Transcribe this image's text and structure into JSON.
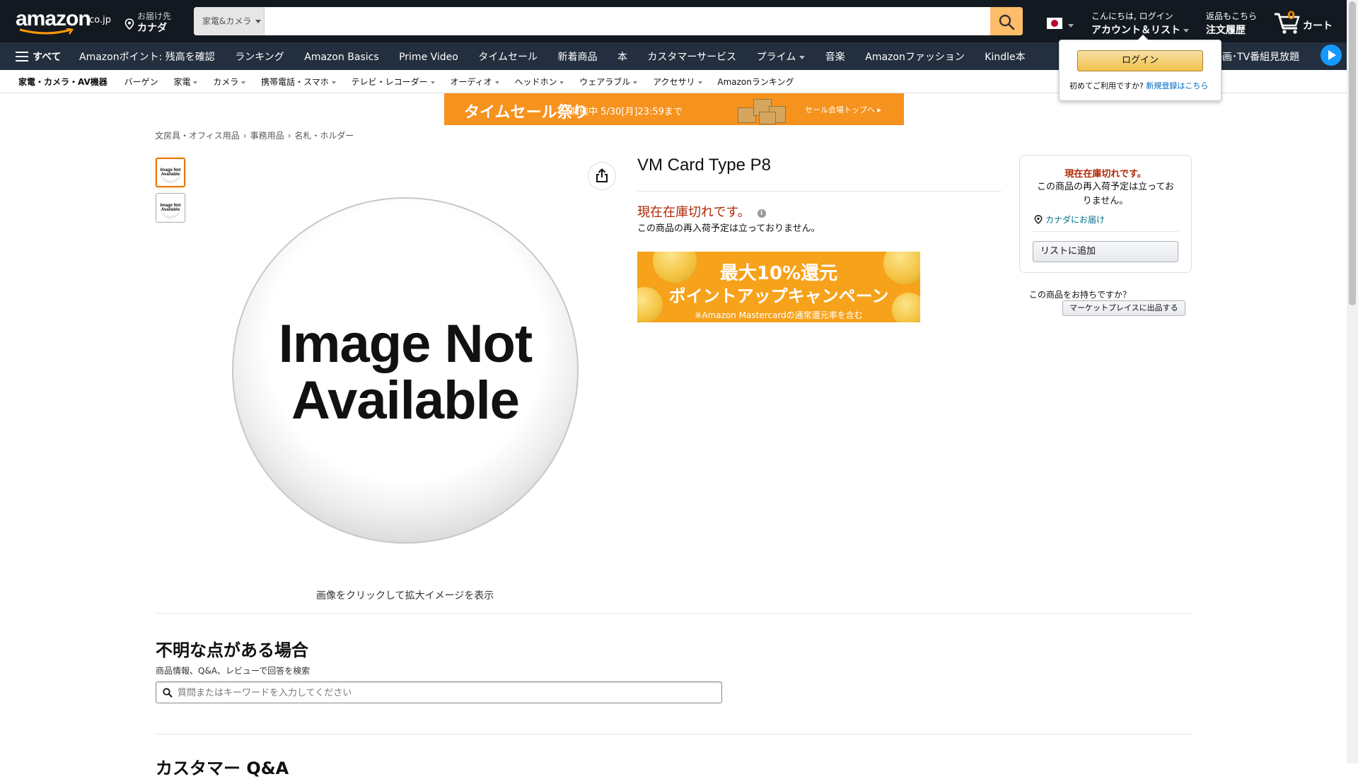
{
  "header": {
    "logo": "amazon",
    "logo_suffix": ".co.jp",
    "deliver_line1": "お届け先",
    "deliver_line2": "カナダ",
    "search_category": "家電&カメラ",
    "search_value": "",
    "search_placeholder": "",
    "account_line1": "こんにちは, ログイン",
    "account_line2": "アカウント＆リスト",
    "orders_line1": "返品もこちら",
    "orders_line2": "注文履歴",
    "cart_count": "0",
    "cart_label": "カート"
  },
  "subnav": {
    "all_label": "すべて",
    "links": [
      "Amazonポイント: 残高を確認",
      "ランキング",
      "Amazon Basics",
      "Prime Video",
      "タイムセール",
      "新着商品",
      "本",
      "カスタマーサービス",
      "プライム",
      "音楽",
      "Amazonファッション",
      "Kindle本"
    ],
    "prime_promo": "の映画･TV番組見放題"
  },
  "catbar": {
    "items": [
      "家電・カメラ・AV機器",
      "バーゲン",
      "家電",
      "カメラ",
      "携帯電話・スマホ",
      "テレビ・レコーダー",
      "オーディオ",
      "ヘッドホン",
      "ウェアラブル",
      "アクセサリ",
      "Amazonランキング"
    ]
  },
  "flyout": {
    "login_label": "ログイン",
    "new_prefix": "初めてご利用ですか?",
    "new_link": "新規登録はこちら"
  },
  "banner": {
    "title": "タイムセール祭り",
    "period": "開催中 5/30[月]23:59まで",
    "cta": "セール会場トップへ ▸"
  },
  "breadcrumb": [
    "文房具・オフィス用品",
    "事務用品",
    "名札・ホルダー"
  ],
  "image": {
    "placeholder_line1": "Image Not",
    "placeholder_line2": "Available",
    "thumb_text": "Image Not Available",
    "click_to_zoom": "画像をクリックして拡大イメージを表示"
  },
  "product": {
    "title": "VM Card Type P8",
    "availability": "現在在庫切れです。",
    "restock": "この商品の再入荷予定は立っておりません。"
  },
  "promo": {
    "line1": "最大10%還元",
    "line2": "ポイントアップキャンペーン",
    "line3": "※Amazon Mastercardの通常還元率を含む"
  },
  "buybox": {
    "availability": "現在在庫切れです。",
    "restock": "この商品の再入荷予定は立っておりません。",
    "deliver_to": "カナダにお届け",
    "add_to_list": "リストに追加",
    "have_item": "この商品をお持ちですか？",
    "sell_button": "マーケットプレイスに出品する"
  },
  "qa": {
    "title": "不明な点がある場合",
    "subtitle": "商品情報、Q&A、レビューで回答を検索",
    "search_placeholder": "質問またはキーワードを入力してください",
    "next_title": "カスタマー Q&A"
  },
  "colors": {
    "nav_bg": "#131921",
    "subnav_bg": "#232f3e",
    "search_button": "#febd69",
    "out_of_stock": "#b12704",
    "link": "#007185",
    "cart_count": "#f08804"
  }
}
